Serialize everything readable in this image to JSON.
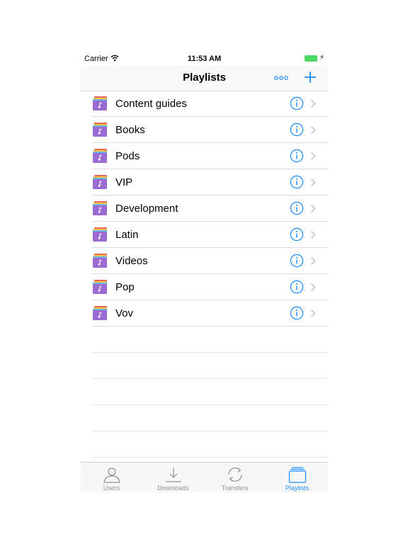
{
  "status_bar": {
    "carrier": "Carrier",
    "time": "11:53 AM"
  },
  "nav": {
    "title": "Playlists",
    "more_icon": "ellipsis-icon",
    "add_icon": "plus-icon"
  },
  "playlists": [
    {
      "label": "Content guides"
    },
    {
      "label": "Books"
    },
    {
      "label": "Pods"
    },
    {
      "label": "VIP"
    },
    {
      "label": "Development"
    },
    {
      "label": "Latin"
    },
    {
      "label": "Videos"
    },
    {
      "label": "Pop"
    },
    {
      "label": "Vov"
    }
  ],
  "tabs": [
    {
      "label": "Users",
      "icon": "user-icon"
    },
    {
      "label": "Downloads",
      "icon": "download-icon"
    },
    {
      "label": "Transfers",
      "icon": "transfer-icon"
    },
    {
      "label": "Playlists",
      "icon": "playlist-icon",
      "active": true
    }
  ],
  "colors": {
    "accent": "#1a8cff",
    "battery": "#4cd964",
    "playlist_icon": "#9b6bd3"
  }
}
